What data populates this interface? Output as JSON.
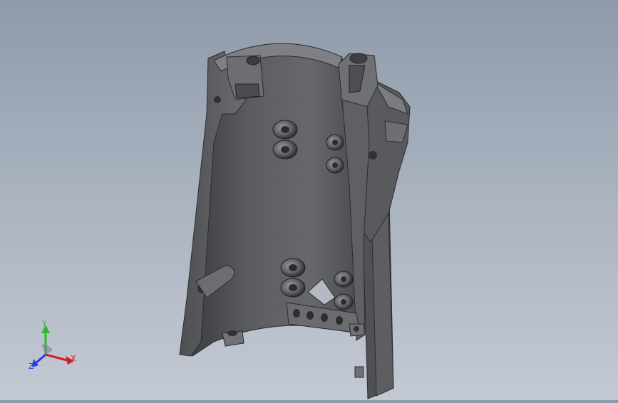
{
  "viewport": {
    "background_top": "#8f9aaa",
    "background_bottom": "#c3c9d3",
    "model_color": "#55575a"
  },
  "triad": {
    "x_label": "X",
    "y_label": "Y",
    "z_label": "Z",
    "x_color": "#d21f1f",
    "y_color": "#2fb52f",
    "z_color": "#2a3fd6"
  }
}
